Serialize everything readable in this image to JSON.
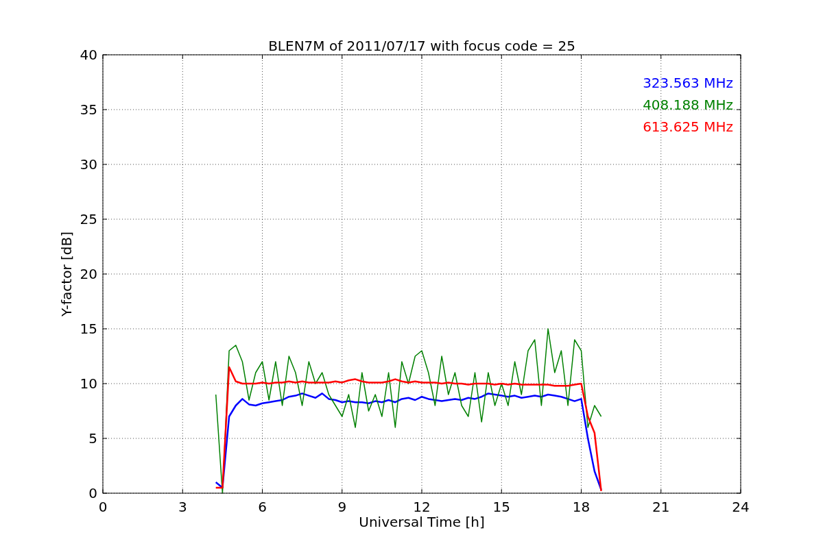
{
  "figure": {
    "chart_data": {
      "type": "line",
      "title": "BLEN7M of 2011/07/17 with focus code = 25",
      "xlabel": "Universal Time [h]",
      "ylabel": "Y-factor [dB]",
      "x": [
        4.25,
        4.5,
        4.75,
        5,
        5.25,
        5.5,
        5.75,
        6,
        6.25,
        6.5,
        6.75,
        7,
        7.25,
        7.5,
        7.75,
        8,
        8.25,
        8.5,
        8.75,
        9,
        9.25,
        9.5,
        9.75,
        10,
        10.25,
        10.5,
        10.75,
        11,
        11.25,
        11.5,
        11.75,
        12,
        12.25,
        12.5,
        12.75,
        13,
        13.25,
        13.5,
        13.75,
        14,
        14.25,
        14.5,
        14.75,
        15,
        15.25,
        15.5,
        15.75,
        16,
        16.25,
        16.5,
        16.75,
        17,
        17.25,
        17.5,
        17.75,
        18,
        18.25,
        18.5,
        18.75
      ],
      "series": [
        {
          "name": "323.563 MHz",
          "color": "#0000ff",
          "values": [
            1,
            0.5,
            7,
            8,
            8.6,
            8.1,
            8,
            8.2,
            8.3,
            8.4,
            8.5,
            8.8,
            8.9,
            9.1,
            8.9,
            8.7,
            9.1,
            8.6,
            8.5,
            8.3,
            8.4,
            8.3,
            8.3,
            8.2,
            8.4,
            8.3,
            8.5,
            8.3,
            8.6,
            8.7,
            8.5,
            8.8,
            8.6,
            8.5,
            8.4,
            8.5,
            8.6,
            8.5,
            8.7,
            8.6,
            8.8,
            9.1,
            9,
            8.9,
            8.8,
            8.9,
            8.7,
            8.8,
            8.9,
            8.8,
            9,
            8.9,
            8.8,
            8.6,
            8.4,
            8.6,
            5,
            2,
            0.3
          ]
        },
        {
          "name": "408.188 MHz",
          "color": "#008000",
          "values": [
            9,
            0,
            13,
            13.5,
            12,
            8.5,
            11,
            12,
            8.5,
            12,
            8,
            12.5,
            11,
            8,
            12,
            10,
            11,
            9,
            8,
            7,
            9,
            6,
            11,
            7.5,
            9,
            7,
            11,
            6,
            12,
            10,
            12.5,
            13,
            11,
            8,
            12.5,
            9,
            11,
            8,
            7,
            11,
            6.5,
            11,
            8,
            10,
            8,
            12,
            9,
            13,
            14,
            8,
            15,
            11,
            13,
            8,
            14,
            13,
            6,
            8,
            7
          ]
        },
        {
          "name": "613.625 MHz",
          "color": "#ff0000",
          "values": [
            0.5,
            0.5,
            11.5,
            10.2,
            10,
            10,
            10,
            10.1,
            10,
            10.1,
            10.1,
            10.2,
            10.1,
            10.2,
            10.1,
            10.1,
            10.1,
            10.1,
            10.2,
            10.1,
            10.3,
            10.4,
            10.2,
            10.1,
            10.1,
            10.1,
            10.2,
            10.4,
            10.2,
            10.1,
            10.2,
            10.1,
            10.1,
            10.1,
            10,
            10.1,
            10,
            10,
            9.9,
            10,
            10,
            10,
            9.9,
            10,
            9.9,
            10,
            9.9,
            9.9,
            9.9,
            9.9,
            9.9,
            9.8,
            9.8,
            9.8,
            9.9,
            10,
            7,
            5.5,
            0.2
          ]
        }
      ],
      "grid": true,
      "xlim": [
        0,
        24
      ],
      "ylim": [
        0,
        40
      ],
      "xticks": [
        0,
        3,
        6,
        9,
        12,
        15,
        18,
        21,
        24
      ],
      "yticks": [
        0,
        5,
        10,
        15,
        20,
        25,
        30,
        35,
        40
      ]
    }
  }
}
